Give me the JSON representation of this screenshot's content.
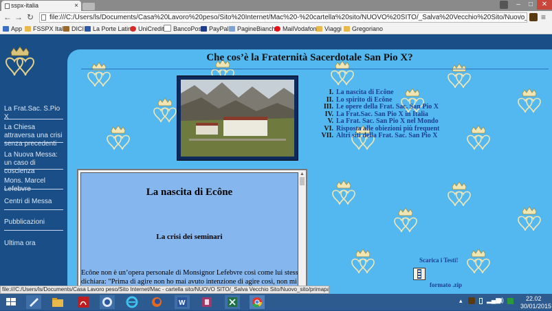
{
  "browser": {
    "tab_title": "sspx-italia",
    "tab_close": "×",
    "window_buttons": [
      "–",
      "□",
      "✕"
    ],
    "url": "file:///C:/Users/ls/Documents/Casa%20Lavoro%20peso/Sito%20Internet/Mac%20-%20cartella%20sito/NUOVO%20SITO/_Salva%20Vecchio%20Sito/Nuovo_sito/prim",
    "bookmarks": [
      "App",
      "FSSPX Italia",
      "DICI",
      "La Porte Latine",
      "UniCredit",
      "BancoPosta",
      "PayPal",
      "PagineBianche",
      "MailVodafone",
      "Viaggi",
      "Gregoriano"
    ],
    "status_url": "file:///C:/Users/ls/Documents/Casa Lavoro peso/Sito Internet/Mac - cartella sito/NUOVO SITO/_Salva Vecchio Sito/Nuovo_sito/primapag/primapag.html"
  },
  "sidebar": {
    "items": [
      "La Frat.Sac. S.Pio X",
      "La Chiesa attraversa una crisi senza precedenti",
      "La Nuova Messa: un caso di coscienza",
      "Mons. Marcel Lefebvre",
      "Centri di Messa",
      "Pubblicazioni",
      "Ultima ora"
    ]
  },
  "main": {
    "title": "Che cos’è la Fraternità Sacerdotale San Pio X?",
    "toc": [
      {
        "num": "I.",
        "label": "La nascita di Ecône"
      },
      {
        "num": "II.",
        "label": "Lo spirito di Ecône"
      },
      {
        "num": "III.",
        "label": "Le opere della Frat. Sac. San Pio X"
      },
      {
        "num": "IV.",
        "label": "La Frat.Sac. San Pio X in Italia"
      },
      {
        "num": "V.",
        "label": "La Frat. Sac. San Pio X nel Mondo"
      },
      {
        "num": "VI.",
        "label": "Risposta alle obiezioni più frequent"
      },
      {
        "num": "VII.",
        "label": "Altri siti della Frat. Sac. San Pio X"
      }
    ],
    "frame": {
      "heading": "La nascita di Ecône",
      "subheading": "La crisi dei seminari",
      "body_line1": "Ecône non è un’opera personale di Monsignor Lefebvre così come lui stesso",
      "body_line2": "dichiara: \"Prima di agire non ho mai avuto intenzione di agire così, non mi"
    },
    "download_label": "Scarica i Testi!",
    "zip_label": "formato .zip"
  },
  "taskbar": {
    "time": "22.02",
    "date": "30/01/2015"
  },
  "colors": {
    "sidebar_bg": "#1a4e86",
    "content_bg": "#54b8f0",
    "toc_link": "#1a3f91"
  }
}
